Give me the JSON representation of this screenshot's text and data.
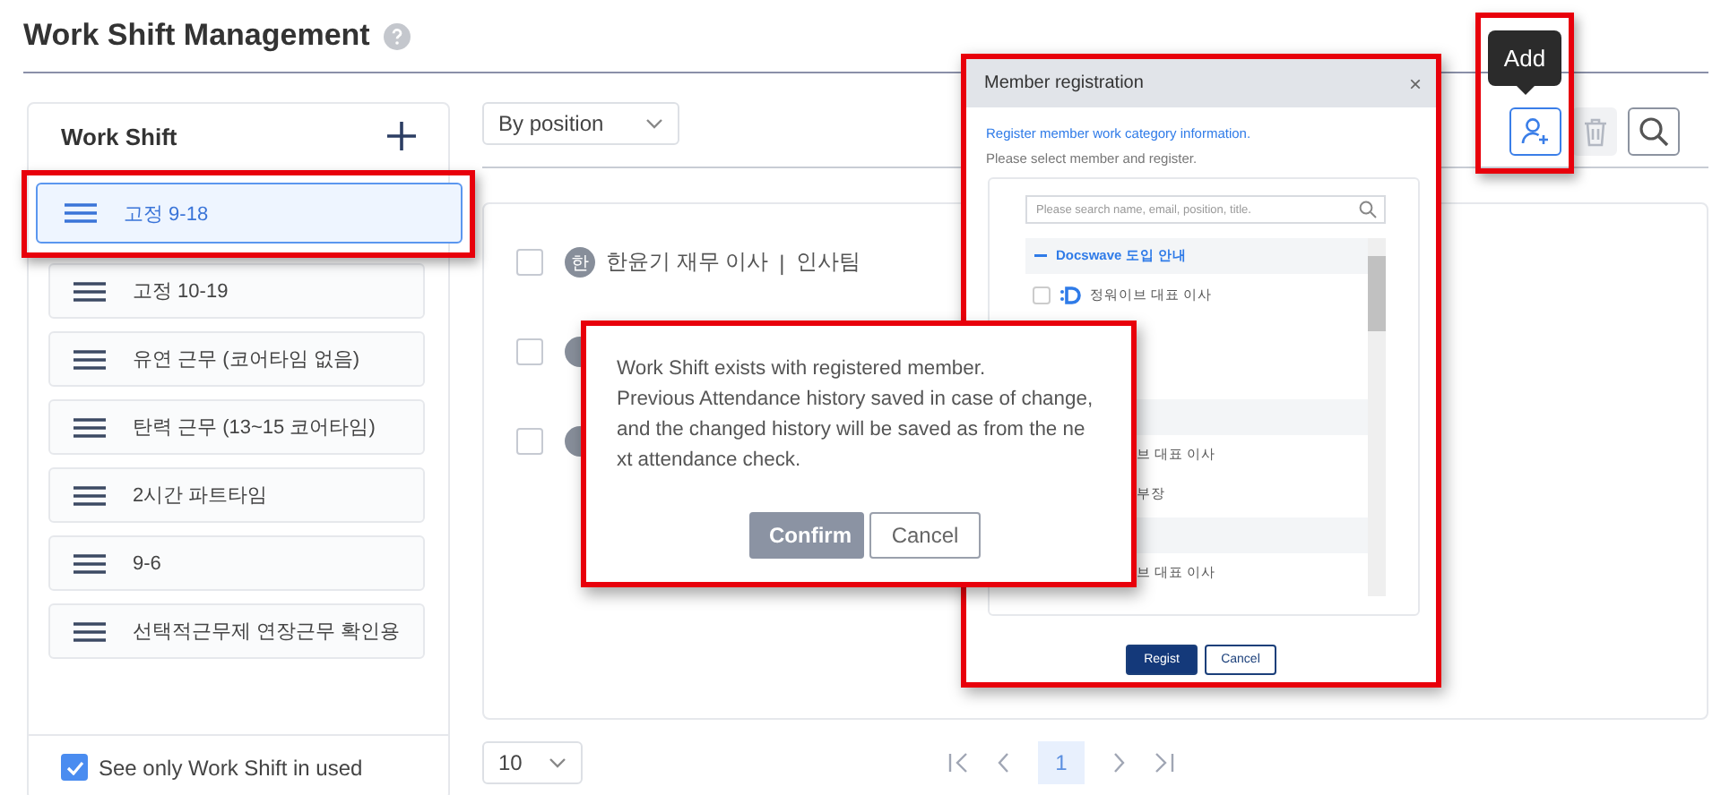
{
  "page": {
    "title": "Work Shift Management"
  },
  "shift_panel": {
    "title": "Work Shift",
    "items": [
      {
        "label": "고정 9-18",
        "selected": true
      },
      {
        "label": "고정 10-19",
        "selected": false
      },
      {
        "label": "유연 근무 (코어타임 없음)",
        "selected": false
      },
      {
        "label": "탄력 근무 (13~15 코어타임)",
        "selected": false
      },
      {
        "label": "2시간 파트타임",
        "selected": false
      },
      {
        "label": "9-6",
        "selected": false
      },
      {
        "label": "선택적근무제 연장근무 확인용",
        "selected": false
      }
    ],
    "filter": {
      "label": "See only Work Shift in used",
      "checked": true
    }
  },
  "toolbar": {
    "group_by": "By position",
    "tooltip": "Add"
  },
  "members": [
    {
      "avatar": "한",
      "name": "한윤기 재무 이사",
      "separator": "|",
      "team": "인사팀",
      "checked": false
    },
    {
      "checked": false
    },
    {
      "checked": false
    }
  ],
  "pagination": {
    "page_size": "10",
    "pages": [
      {
        "label": "1",
        "selected": true
      }
    ]
  },
  "member_dialog": {
    "title": "Member registration",
    "close": "×",
    "intro": "Register member work category information.",
    "hint": "Please select member and register.",
    "search": {
      "placeholder": "Please search name, email, position, title."
    },
    "tree": [
      {
        "kind": "group",
        "label": "Docswave 도입 안내",
        "expanded": true
      },
      {
        "kind": "member",
        "label": "정워이브 대표 이사",
        "checked": false
      },
      {
        "kind": "spacer"
      },
      {
        "kind": "group"
      },
      {
        "kind": "covered",
        "label": "브 대표 이사"
      },
      {
        "kind": "covered",
        "label": "부장"
      },
      {
        "kind": "group"
      },
      {
        "kind": "covered",
        "label": "브 대표 이사"
      }
    ],
    "buttons": [
      {
        "label": "Regist",
        "kind": "primary"
      },
      {
        "label": "Cancel",
        "kind": "secondary"
      }
    ]
  },
  "confirm_dialog": {
    "message": [
      "Work Shift exists with registered member.",
      "Previous Attendance history saved in case of change, and the changed history will be saved as from the next attendance check."
    ],
    "buttons": [
      {
        "label": "Confirm",
        "kind": "primary"
      },
      {
        "label": "Cancel",
        "kind": "secondary"
      }
    ]
  }
}
